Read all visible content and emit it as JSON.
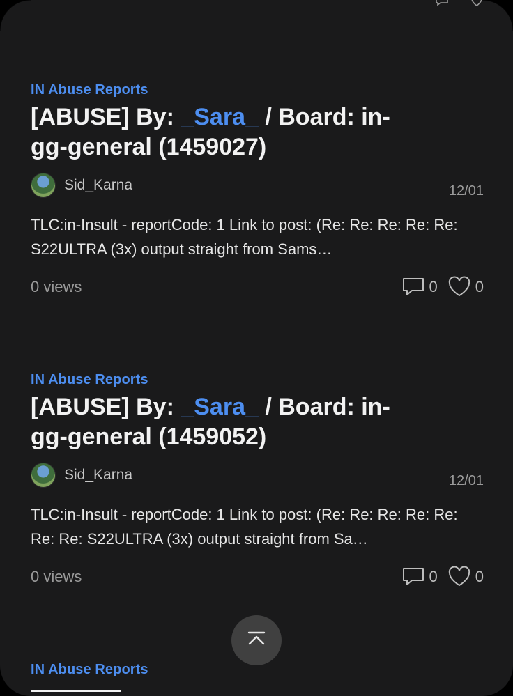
{
  "posts": [
    {
      "board": "IN Abuse Reports",
      "title_prefix": "[ABUSE] By: ",
      "title_user": "_Sara_",
      "title_suffix": " / Board: in-gg-general (1459027)",
      "author": "Sid_Karna",
      "date": "12/01",
      "excerpt": "TLC:in-Insult - reportCode: 1 Link to post: (Re: Re: Re: Re: Re: S22ULTRA (3x) output straight from Sams…",
      "views": "0 views",
      "comments": "0",
      "likes": "0"
    },
    {
      "board": "IN Abuse Reports",
      "title_prefix": "[ABUSE] By: ",
      "title_user": "_Sara_",
      "title_suffix": " / Board: in-gg-general (1459052)",
      "author": "Sid_Karna",
      "date": "12/01",
      "excerpt": "TLC:in-Insult - reportCode: 1 Link to post: (Re: Re: Re: Re: Re: Re: Re: S22ULTRA (3x) output straight from Sa…",
      "views": "0 views",
      "comments": "0",
      "likes": "0"
    },
    {
      "board": "IN Abuse Reports"
    }
  ],
  "icons": {
    "comment": "comment-icon",
    "like": "heart-icon",
    "scroll_top": "scroll-to-top-icon"
  },
  "colors": {
    "background": "#1a1a1b",
    "accent": "#4d8ef0",
    "text": "#f2f2f2",
    "muted": "#9a9a9a",
    "fab": "#404040"
  }
}
